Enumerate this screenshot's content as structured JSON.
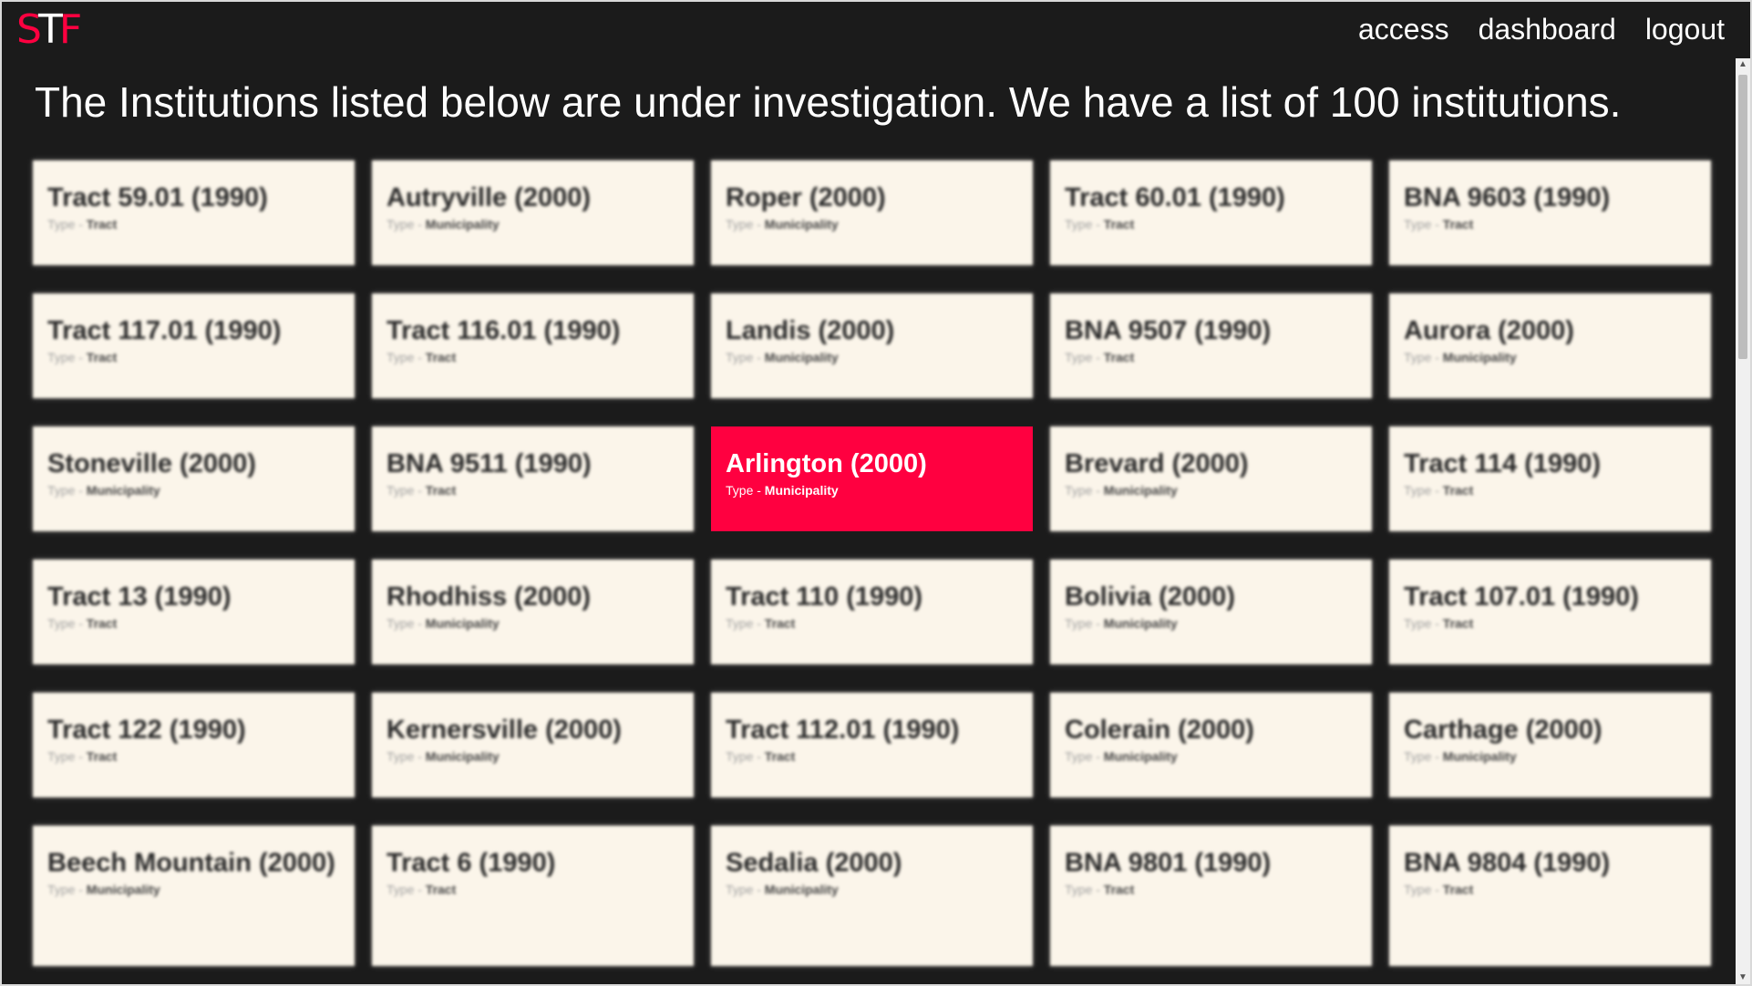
{
  "logo": {
    "left": "S",
    "mid": "T",
    "right": "F"
  },
  "nav": {
    "access": "access",
    "dashboard": "dashboard",
    "logout": "logout"
  },
  "headline": "The Institutions listed below are under investigation. We have a list of 100 institutions.",
  "type_prefix": "Type - ",
  "cards": [
    {
      "name": "Tract 59.01 (1990)",
      "type": "Tract"
    },
    {
      "name": "Autryville (2000)",
      "type": "Municipality"
    },
    {
      "name": "Roper (2000)",
      "type": "Municipality"
    },
    {
      "name": "Tract 60.01 (1990)",
      "type": "Tract"
    },
    {
      "name": "BNA 9603 (1990)",
      "type": "Tract"
    },
    {
      "name": "Tract 117.01 (1990)",
      "type": "Tract"
    },
    {
      "name": "Tract 116.01 (1990)",
      "type": "Tract"
    },
    {
      "name": "Landis (2000)",
      "type": "Municipality"
    },
    {
      "name": "BNA 9507 (1990)",
      "type": "Tract"
    },
    {
      "name": "Aurora (2000)",
      "type": "Municipality"
    },
    {
      "name": "Stoneville (2000)",
      "type": "Municipality"
    },
    {
      "name": "BNA 9511 (1990)",
      "type": "Tract"
    },
    {
      "name": "Arlington (2000)",
      "type": "Municipality"
    },
    {
      "name": "Brevard (2000)",
      "type": "Municipality"
    },
    {
      "name": "Tract 114 (1990)",
      "type": "Tract"
    },
    {
      "name": "Tract 13 (1990)",
      "type": "Tract"
    },
    {
      "name": "Rhodhiss (2000)",
      "type": "Municipality"
    },
    {
      "name": "Tract 110 (1990)",
      "type": "Tract"
    },
    {
      "name": "Bolivia (2000)",
      "type": "Municipality"
    },
    {
      "name": "Tract 107.01 (1990)",
      "type": "Tract"
    },
    {
      "name": "Tract 122 (1990)",
      "type": "Tract"
    },
    {
      "name": "Kernersville (2000)",
      "type": "Municipality"
    },
    {
      "name": "Tract 112.01 (1990)",
      "type": "Tract"
    },
    {
      "name": "Colerain (2000)",
      "type": "Municipality"
    },
    {
      "name": "Carthage (2000)",
      "type": "Municipality"
    },
    {
      "name": "Beech Mountain (2000)",
      "type": "Municipality"
    },
    {
      "name": "Tract 6 (1990)",
      "type": "Tract"
    },
    {
      "name": "Sedalia (2000)",
      "type": "Municipality"
    },
    {
      "name": "BNA 9801 (1990)",
      "type": "Tract"
    },
    {
      "name": "BNA 9804 (1990)",
      "type": "Tract"
    }
  ],
  "colors": {
    "background": "#1b1b1b",
    "accent": "#ff0040",
    "card": "#fbf5ea"
  }
}
